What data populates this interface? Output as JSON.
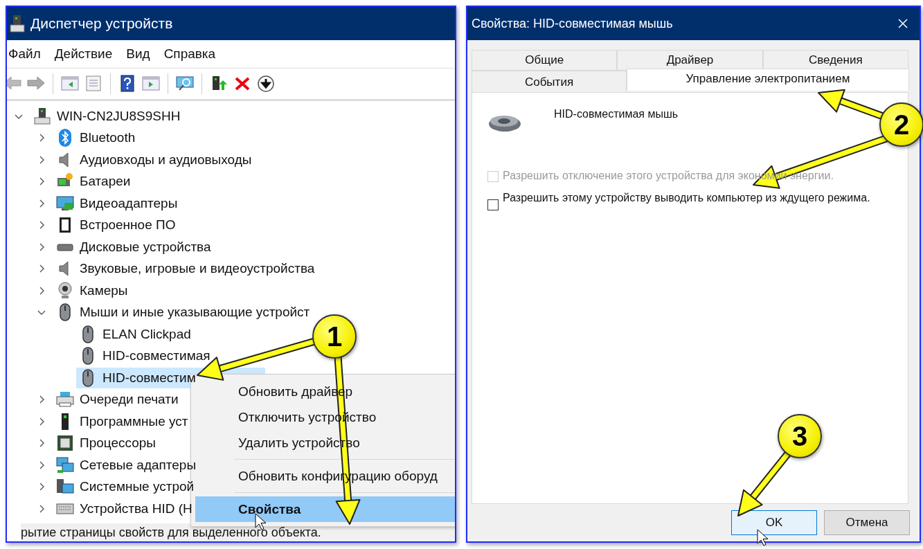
{
  "device_manager": {
    "title": "Диспетчер устройств",
    "menu": [
      "Файл",
      "Действие",
      "Вид",
      "Справка"
    ],
    "tree": {
      "label": "WIN-CN2JU8S9SHH",
      "expanded": true,
      "selected": false,
      "children": [
        {
          "label": "Bluetooth",
          "expanded": false,
          "selected": false
        },
        {
          "label": "Аудиовходы и аудиовыходы",
          "expanded": false,
          "selected": false
        },
        {
          "label": "Батареи",
          "expanded": false,
          "selected": false
        },
        {
          "label": "Видеоадаптеры",
          "expanded": false,
          "selected": false
        },
        {
          "label": "Встроенное ПО",
          "expanded": false,
          "selected": false
        },
        {
          "label": "Дисковые устройства",
          "expanded": false,
          "selected": false
        },
        {
          "label": "Звуковые, игровые и видеоустройства",
          "expanded": false,
          "selected": false
        },
        {
          "label": "Камеры",
          "expanded": false,
          "selected": false
        },
        {
          "label": "Мыши и иные указывающие устройст",
          "expanded": true,
          "selected": false,
          "children": [
            {
              "label": "ELAN Clickpad",
              "selected": false
            },
            {
              "label": "HID-совместимая",
              "selected": false
            },
            {
              "label": "HID-совместим",
              "selected": true
            }
          ]
        },
        {
          "label": "Очереди печати",
          "expanded": false,
          "selected": false
        },
        {
          "label": "Программные уст",
          "expanded": false,
          "selected": false
        },
        {
          "label": "Процессоры",
          "expanded": false,
          "selected": false
        },
        {
          "label": "Сетевые адаптеры",
          "expanded": false,
          "selected": false
        },
        {
          "label": "Системные устрой",
          "expanded": false,
          "selected": false
        },
        {
          "label": "Устройства HID (Н",
          "expanded": false,
          "selected": false
        }
      ]
    },
    "context_menu": [
      {
        "kind": "item",
        "label": "Обновить драйвер",
        "selected": false
      },
      {
        "kind": "item",
        "label": "Отключить устройство",
        "selected": false
      },
      {
        "kind": "item",
        "label": "Удалить устройство",
        "selected": false
      },
      {
        "kind": "separator"
      },
      {
        "kind": "item",
        "label": "Обновить конфигурацию оборуд",
        "selected": false
      },
      {
        "kind": "separator"
      },
      {
        "kind": "item",
        "label": "Свойства",
        "selected": true
      }
    ],
    "status_bar": "рытие страницы свойств для выделенного объекта."
  },
  "properties": {
    "title": "Свойства: HID-совместимая мышь",
    "tab_rows": [
      {
        "tabs": [
          {
            "label": "Общие",
            "selected": false
          },
          {
            "label": "Драйвер",
            "selected": false
          },
          {
            "label": "Сведения",
            "selected": false
          }
        ]
      },
      {
        "tabs": [
          {
            "label": "События",
            "selected": false
          },
          {
            "label": "Управление электропитанием",
            "selected": true
          }
        ]
      }
    ],
    "device_name": "HID-совместимая мышь",
    "options": [
      {
        "label": "Разрешить отключение этого устройства для экономии энергии.",
        "checked": false,
        "disabled": true
      },
      {
        "label": "Разрешить этому устройству выводить компьютер из ждущего режима.",
        "checked": false,
        "disabled": false
      }
    ],
    "buttons": [
      {
        "label": "OK",
        "default": true
      },
      {
        "label": "Отмена",
        "default": false
      }
    ]
  },
  "callouts": [
    {
      "number": "1"
    },
    {
      "number": "2"
    },
    {
      "number": "3"
    }
  ]
}
